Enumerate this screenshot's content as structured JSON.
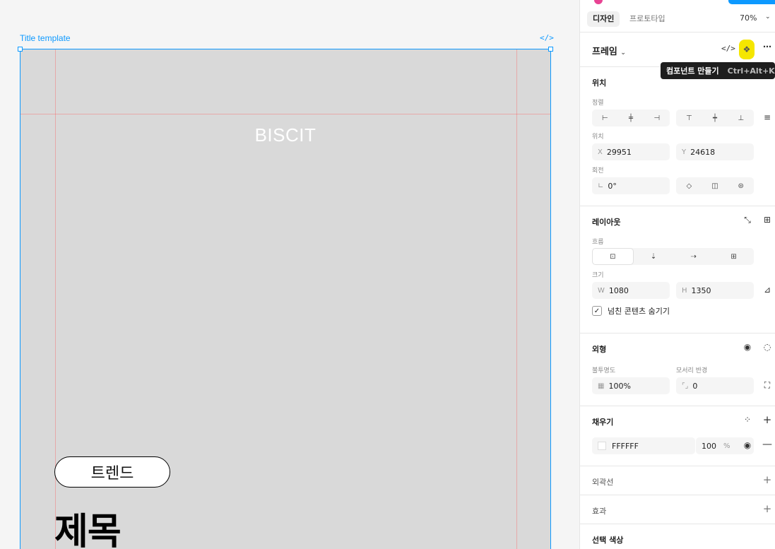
{
  "canvas": {
    "frame_label": "Title template",
    "code_icon": "</>",
    "brand_text": "BISCIT",
    "tag_text": "트렌드",
    "title_text": "제목"
  },
  "panel": {
    "tabs": [
      "디자인",
      "프로토타입"
    ],
    "zoom": "70%",
    "frame_heading": "프레임",
    "tooltip": {
      "label": "컴포넌트 만들기",
      "shortcut": "Ctrl+Alt+K"
    },
    "position": {
      "title": "위치",
      "align_label": "정렬",
      "position_label": "위치",
      "x_prefix": "X",
      "x_value": "29951",
      "y_prefix": "Y",
      "y_value": "24618",
      "rotation_label": "회전",
      "rotation_value": "0°"
    },
    "layout": {
      "title": "레이아웃",
      "flow_label": "흐름",
      "size_label": "크기",
      "w_prefix": "W",
      "w_value": "1080",
      "h_prefix": "H",
      "h_value": "1350",
      "clip_label": "넘친 콘텐츠 숨기기"
    },
    "appearance": {
      "title": "외형",
      "opacity_label": "불투명도",
      "opacity_value": "100%",
      "radius_label": "모서리 반경",
      "radius_value": "0"
    },
    "fill": {
      "title": "채우기",
      "hex": "FFFFFF",
      "opacity": "100",
      "percent": "%"
    },
    "stroke_title": "외곽선",
    "effects_title": "효과",
    "selection_colors_title": "선택 색상"
  },
  "colors": {
    "accent": "#0d99ff",
    "frame_bg": "#d9d9d9",
    "highlight": "#f5e600",
    "guide": "#ff5050"
  }
}
